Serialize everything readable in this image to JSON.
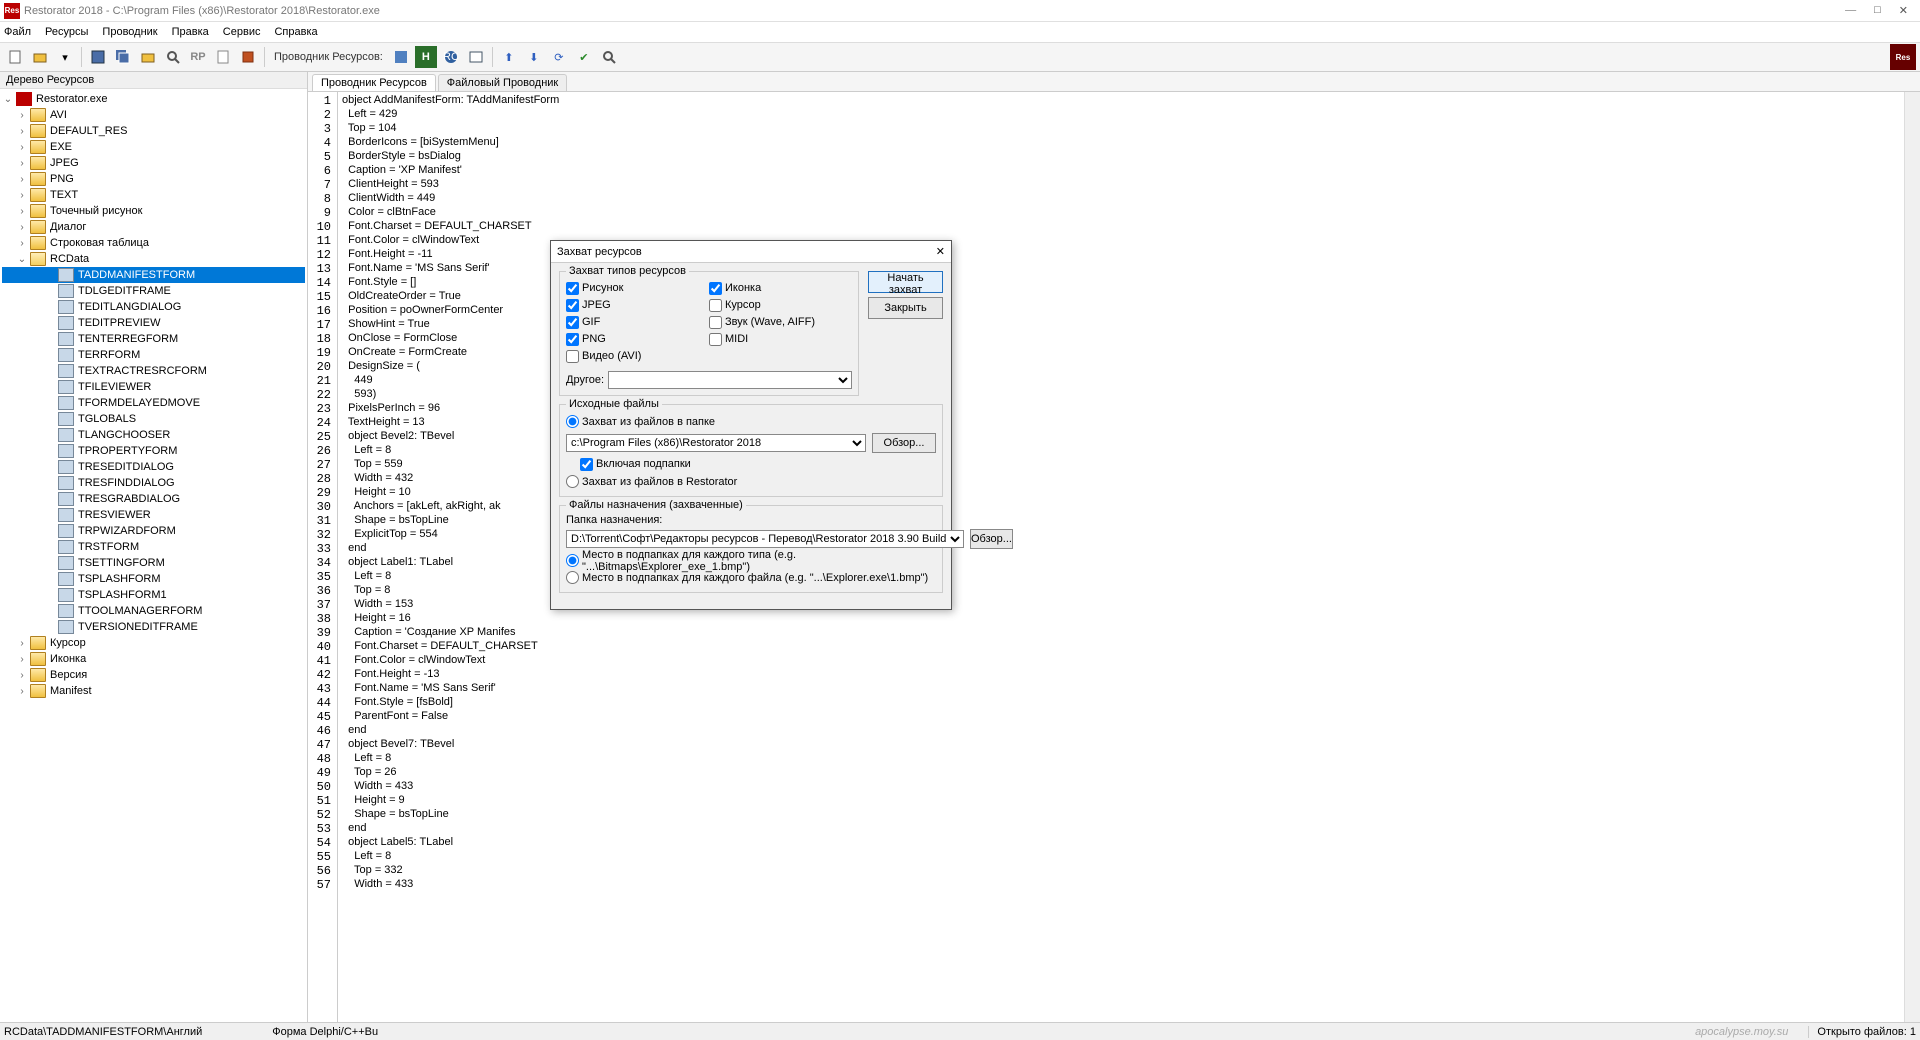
{
  "window": {
    "title": "Restorator 2018 - C:\\Program Files (x86)\\Restorator 2018\\Restorator.exe",
    "app_badge": "Res"
  },
  "win_buttons": {
    "min": "—",
    "max": "□",
    "close": "✕"
  },
  "menu": [
    "Файл",
    "Ресурсы",
    "Проводник",
    "Правка",
    "Сервис",
    "Справка"
  ],
  "toolbar_label": "Проводник Ресурсов:",
  "logo": "Res",
  "sidebar": {
    "title": "Дерево Ресурсов",
    "root": "Restorator.exe",
    "folders": [
      "AVI",
      "DEFAULT_RES",
      "EXE",
      "JPEG",
      "PNG",
      "TEXT",
      "Точечный рисунок",
      "Диалог",
      "Строковая таблица"
    ],
    "open_folder": "RCData",
    "rcdata": [
      "TADDMANIFESTFORM",
      "TDLGEDITFRAME",
      "TEDITLANGDIALOG",
      "TEDITPREVIEW",
      "TENTERREGFORM",
      "TERRFORM",
      "TEXTRACTRESRCFORM",
      "TFILEVIEWER",
      "TFORMDELAYEDMOVE",
      "TGLOBALS",
      "TLANGCHOOSER",
      "TPROPERTYFORM",
      "TRESEDITDIALOG",
      "TRESFINDDIALOG",
      "TRESGRABDIALOG",
      "TRESVIEWER",
      "TRPWIZARDFORM",
      "TRSTFORM",
      "TSETTINGFORM",
      "TSPLASHFORM",
      "TSPLASHFORM1",
      "TTOOLMANAGERFORM",
      "TVERSIONEDITFRAME"
    ],
    "folders2": [
      "Курсор",
      "Иконка",
      "Версия",
      "Manifest"
    ]
  },
  "tabs": {
    "a": "Проводник Ресурсов",
    "b": "Файловый Проводник"
  },
  "code": [
    "object AddManifestForm: TAddManifestForm",
    "  Left = 429",
    "  Top = 104",
    "  BorderIcons = [biSystemMenu]",
    "  BorderStyle = bsDialog",
    "  Caption = 'XP Manifest'",
    "  ClientHeight = 593",
    "  ClientWidth = 449",
    "  Color = clBtnFace",
    "  Font.Charset = DEFAULT_CHARSET",
    "  Font.Color = clWindowText",
    "  Font.Height = -11",
    "  Font.Name = 'MS Sans Serif'",
    "  Font.Style = []",
    "  OldCreateOrder = True",
    "  Position = poOwnerFormCenter",
    "  ShowHint = True",
    "  OnClose = FormClose",
    "  OnCreate = FormCreate",
    "  DesignSize = (",
    "    449",
    "    593)",
    "  PixelsPerInch = 96",
    "  TextHeight = 13",
    "  object Bevel2: TBevel",
    "    Left = 8",
    "    Top = 559",
    "    Width = 432",
    "    Height = 10",
    "    Anchors = [akLeft, akRight, ak",
    "    Shape = bsTopLine",
    "    ExplicitTop = 554",
    "  end",
    "  object Label1: TLabel",
    "    Left = 8",
    "    Top = 8",
    "    Width = 153",
    "    Height = 16",
    "    Caption = 'Создание XP Manifes",
    "    Font.Charset = DEFAULT_CHARSET",
    "    Font.Color = clWindowText",
    "    Font.Height = -13",
    "    Font.Name = 'MS Sans Serif'",
    "    Font.Style = [fsBold]",
    "    ParentFont = False",
    "  end",
    "  object Bevel7: TBevel",
    "    Left = 8",
    "    Top = 26",
    "    Width = 433",
    "    Height = 9",
    "    Shape = bsTopLine",
    "  end",
    "  object Label5: TLabel",
    "    Left = 8",
    "    Top = 332",
    "    Width = 433"
  ],
  "dialog": {
    "title": "Захват ресурсов",
    "group1": "Захват типов ресурсов",
    "checks_left": [
      {
        "l": "Рисунок",
        "c": true
      },
      {
        "l": "JPEG",
        "c": true
      },
      {
        "l": "GIF",
        "c": true
      },
      {
        "l": "PNG",
        "c": true
      },
      {
        "l": "Видео (AVI)",
        "c": false
      }
    ],
    "checks_right": [
      {
        "l": "Иконка",
        "c": true
      },
      {
        "l": "Курсор",
        "c": false
      },
      {
        "l": "Звук (Wave, AIFF)",
        "c": false
      },
      {
        "l": "MIDI",
        "c": false
      }
    ],
    "other": "Другое:",
    "group2": "Исходные файлы",
    "r1": "Захват из файлов в папке",
    "path1": "c:\\Program Files (x86)\\Restorator 2018",
    "browse": "Обзор...",
    "incl": "Включая подпапки",
    "r2": "Захват из файлов в Restorator",
    "group3": "Файлы назначения (захваченные)",
    "destlbl": "Папка назначения:",
    "path2": "D:\\Torrent\\Софт\\Редакторы ресурсов - Перевод\\Restorator 2018 3.90 Build",
    "r3": "Место в подпапках для каждого типа (e.g. \"...\\Bitmaps\\Explorer_exe_1.bmp\")",
    "r4": "Место в подпапках для каждого файла (e.g. \"...\\Explorer.exe\\1.bmp\")",
    "btn_start": "Начать захват",
    "btn_close": "Закрыть"
  },
  "status": {
    "left": "RCData\\TADDMANIFESTFORM\\Англий",
    "mid": "Форма Delphi/C++Bu",
    "wm": "apocalypse.moy.su",
    "right": "Открыто файлов: 1"
  }
}
